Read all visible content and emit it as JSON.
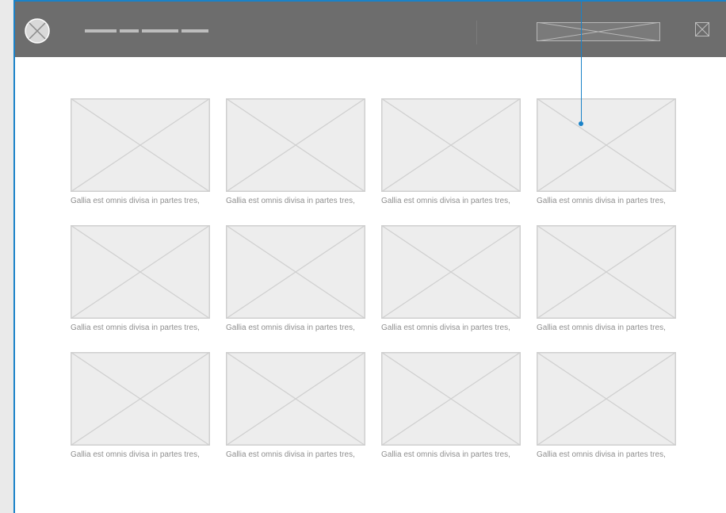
{
  "header": {
    "logo_icon": "logo-placeholder-icon",
    "nav_items": [
      {
        "width": 40
      },
      {
        "width": 24
      },
      {
        "width": 46
      },
      {
        "width": 34
      }
    ],
    "search_icon": "search-box-placeholder-icon",
    "close_icon": "close-icon"
  },
  "gallery": {
    "items": [
      {
        "caption": "Gallia est omnis divisa in partes tres,"
      },
      {
        "caption": "Gallia est omnis divisa in partes tres,"
      },
      {
        "caption": "Gallia est omnis divisa in partes tres,"
      },
      {
        "caption": "Gallia est omnis divisa in partes tres,"
      },
      {
        "caption": "Gallia est omnis divisa in partes tres,"
      },
      {
        "caption": "Gallia est omnis divisa in partes tres,"
      },
      {
        "caption": "Gallia est omnis divisa in partes tres,"
      },
      {
        "caption": "Gallia est omnis divisa in partes tres,"
      },
      {
        "caption": "Gallia est omnis divisa in partes tres,"
      },
      {
        "caption": "Gallia est omnis divisa in partes tres,"
      },
      {
        "caption": "Gallia est omnis divisa in partes tres,"
      },
      {
        "caption": "Gallia est omnis divisa in partes tres,"
      }
    ]
  },
  "colors": {
    "header_bg": "#6d6d6d",
    "accent": "#1a82c8",
    "placeholder_fill": "#ededed",
    "placeholder_stroke": "#cfcfcf",
    "caption_text": "#8f8f8f"
  }
}
